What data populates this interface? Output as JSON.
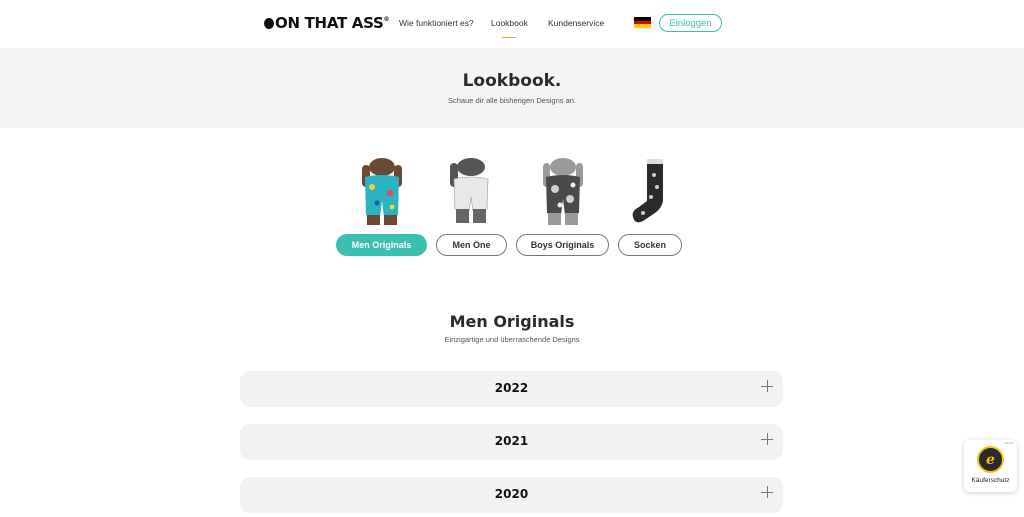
{
  "header": {
    "logo_text": "ON THAT ASS",
    "logo_reg": "®",
    "nav": [
      {
        "label": "Wie funktioniert es?"
      },
      {
        "label": "Lookbook"
      },
      {
        "label": "Kundenservice"
      }
    ],
    "login_label": "Einloggen",
    "flag_colors": [
      "#000000",
      "#dd0000",
      "#ffce00"
    ]
  },
  "hero": {
    "title": "Lookbook.",
    "subtitle": "Schaue dir alle bisherigen Designs an."
  },
  "categories": [
    {
      "label": "Men Originals",
      "active": true
    },
    {
      "label": "Men One",
      "active": false
    },
    {
      "label": "Boys Originals",
      "active": false
    },
    {
      "label": "Socken",
      "active": false
    }
  ],
  "section": {
    "title": "Men Originals",
    "subtitle": "Einzigartige und überraschende Designs"
  },
  "years": [
    "2022",
    "2021",
    "2020"
  ],
  "badge": {
    "label": "Käuferschutz"
  },
  "colors": {
    "accent": "#3dbfb0",
    "hero_bg": "#f4f4f3",
    "accordion_bg": "#f2f2f2"
  }
}
